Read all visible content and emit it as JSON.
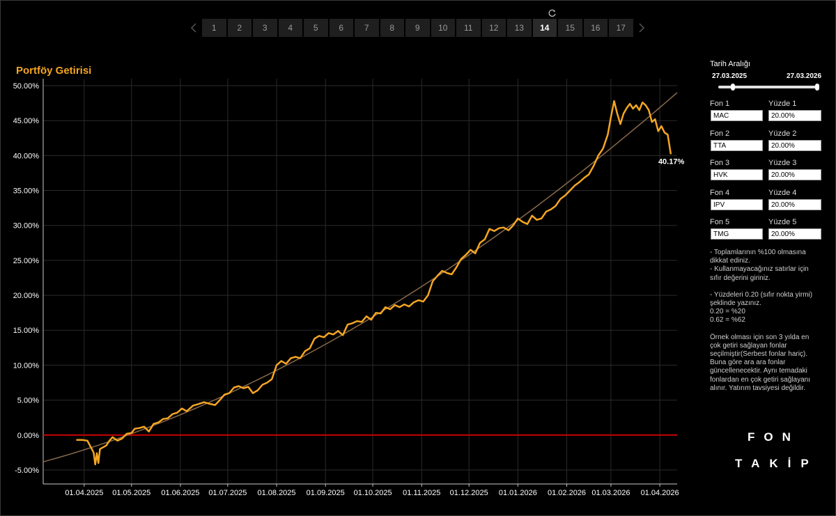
{
  "pager": {
    "pages": [
      "1",
      "2",
      "3",
      "4",
      "5",
      "6",
      "7",
      "8",
      "9",
      "10",
      "11",
      "12",
      "13",
      "14",
      "15",
      "16",
      "17"
    ],
    "active": "14",
    "prev_icon": "chevron-left-icon",
    "next_icon": "chevron-right-icon",
    "refresh_icon": "refresh-icon"
  },
  "chart": {
    "title": "Portföy Getirisi",
    "last_label": "40.17%"
  },
  "chart_data": {
    "type": "line",
    "title": "Portföy Getirisi",
    "ylim": [
      -7,
      51
    ],
    "y_ticks": [
      "-5.00%",
      "0.00%",
      "5.00%",
      "10.00%",
      "15.00%",
      "20.00%",
      "25.00%",
      "30.00%",
      "35.00%",
      "40.00%",
      "45.00%",
      "50.00%"
    ],
    "x_ticks": [
      "01.04.2025",
      "01.05.2025",
      "01.06.2025",
      "01.07.2025",
      "01.08.2025",
      "01.09.2025",
      "01.10.2025",
      "01.11.2025",
      "01.12.2025",
      "01.01.2026",
      "01.02.2026",
      "01.03.2026",
      "01.04.2026"
    ],
    "x_range": [
      "2025-03-06",
      "2026-04-12"
    ],
    "grid": true,
    "colors": {
      "portfolio": "#f5a623",
      "trend": "#8a6a4a",
      "zero": "#cc0000"
    },
    "series": [
      {
        "points": [
          [
            "2025-03-27",
            -0.7
          ],
          [
            "2025-03-31",
            -0.7
          ],
          [
            "2025-04-03",
            -0.8
          ],
          [
            "2025-04-07",
            -2.5
          ],
          [
            "2025-04-08",
            -4.2
          ],
          [
            "2025-04-09",
            -2.6
          ],
          [
            "2025-04-10",
            -4.0
          ],
          [
            "2025-04-11",
            -2.0
          ],
          [
            "2025-04-15",
            -1.5
          ],
          [
            "2025-04-17",
            -0.8
          ],
          [
            "2025-04-19",
            -0.3
          ],
          [
            "2025-04-22",
            -0.8
          ],
          [
            "2025-04-25",
            -0.5
          ],
          [
            "2025-04-28",
            0.2
          ],
          [
            "2025-05-01",
            0.3
          ],
          [
            "2025-05-03",
            0.9
          ],
          [
            "2025-05-06",
            1.0
          ],
          [
            "2025-05-09",
            1.2
          ],
          [
            "2025-05-12",
            0.5
          ],
          [
            "2025-05-15",
            1.6
          ],
          [
            "2025-05-18",
            1.8
          ],
          [
            "2025-05-21",
            2.3
          ],
          [
            "2025-05-24",
            2.4
          ],
          [
            "2025-05-27",
            3.0
          ],
          [
            "2025-05-30",
            3.2
          ],
          [
            "2025-06-02",
            3.8
          ],
          [
            "2025-06-05",
            3.4
          ],
          [
            "2025-06-09",
            4.2
          ],
          [
            "2025-06-12",
            4.4
          ],
          [
            "2025-06-16",
            4.7
          ],
          [
            "2025-06-19",
            4.5
          ],
          [
            "2025-06-23",
            4.3
          ],
          [
            "2025-06-26",
            5.0
          ],
          [
            "2025-06-29",
            5.8
          ],
          [
            "2025-07-02",
            6.0
          ],
          [
            "2025-07-05",
            6.8
          ],
          [
            "2025-07-08",
            7.0
          ],
          [
            "2025-07-11",
            6.7
          ],
          [
            "2025-07-14",
            6.9
          ],
          [
            "2025-07-17",
            6.0
          ],
          [
            "2025-07-20",
            6.4
          ],
          [
            "2025-07-23",
            7.2
          ],
          [
            "2025-07-26",
            7.5
          ],
          [
            "2025-07-29",
            8.0
          ],
          [
            "2025-08-01",
            10.0
          ],
          [
            "2025-08-04",
            10.6
          ],
          [
            "2025-08-07",
            10.2
          ],
          [
            "2025-08-10",
            11.0
          ],
          [
            "2025-08-13",
            11.2
          ],
          [
            "2025-08-16",
            11.0
          ],
          [
            "2025-08-19",
            12.0
          ],
          [
            "2025-08-22",
            12.4
          ],
          [
            "2025-08-25",
            13.8
          ],
          [
            "2025-08-28",
            14.2
          ],
          [
            "2025-08-31",
            14.0
          ],
          [
            "2025-09-03",
            14.6
          ],
          [
            "2025-09-06",
            14.4
          ],
          [
            "2025-09-09",
            14.9
          ],
          [
            "2025-09-12",
            14.3
          ],
          [
            "2025-09-15",
            15.8
          ],
          [
            "2025-09-18",
            16.0
          ],
          [
            "2025-09-21",
            16.3
          ],
          [
            "2025-09-24",
            16.2
          ],
          [
            "2025-09-27",
            17.0
          ],
          [
            "2025-09-30",
            16.5
          ],
          [
            "2025-10-03",
            17.5
          ],
          [
            "2025-10-06",
            17.4
          ],
          [
            "2025-10-09",
            18.3
          ],
          [
            "2025-10-12",
            18.0
          ],
          [
            "2025-10-15",
            18.6
          ],
          [
            "2025-10-18",
            18.3
          ],
          [
            "2025-10-21",
            18.7
          ],
          [
            "2025-10-24",
            18.4
          ],
          [
            "2025-10-27",
            19.0
          ],
          [
            "2025-10-30",
            19.3
          ],
          [
            "2025-11-02",
            19.1
          ],
          [
            "2025-11-05",
            20.0
          ],
          [
            "2025-11-08",
            22.0
          ],
          [
            "2025-11-11",
            22.8
          ],
          [
            "2025-11-14",
            23.5
          ],
          [
            "2025-11-17",
            23.2
          ],
          [
            "2025-11-20",
            23.0
          ],
          [
            "2025-11-23",
            24.0
          ],
          [
            "2025-11-26",
            25.2
          ],
          [
            "2025-11-29",
            25.8
          ],
          [
            "2025-12-02",
            26.5
          ],
          [
            "2025-12-05",
            26.0
          ],
          [
            "2025-12-08",
            27.5
          ],
          [
            "2025-12-11",
            28.0
          ],
          [
            "2025-12-14",
            29.5
          ],
          [
            "2025-12-17",
            29.2
          ],
          [
            "2025-12-20",
            29.6
          ],
          [
            "2025-12-23",
            29.7
          ],
          [
            "2025-12-26",
            29.3
          ],
          [
            "2025-12-29",
            30.0
          ],
          [
            "2026-01-01",
            31.0
          ],
          [
            "2026-01-04",
            30.5
          ],
          [
            "2026-01-07",
            30.2
          ],
          [
            "2026-01-10",
            31.4
          ],
          [
            "2026-01-13",
            30.8
          ],
          [
            "2026-01-16",
            31.0
          ],
          [
            "2026-01-19",
            32.0
          ],
          [
            "2026-01-22",
            32.3
          ],
          [
            "2026-01-25",
            32.8
          ],
          [
            "2026-01-28",
            33.8
          ],
          [
            "2026-01-31",
            34.3
          ],
          [
            "2026-02-03",
            35.0
          ],
          [
            "2026-02-06",
            35.7
          ],
          [
            "2026-02-09",
            36.2
          ],
          [
            "2026-02-12",
            36.8
          ],
          [
            "2026-02-15",
            37.3
          ],
          [
            "2026-02-18",
            38.5
          ],
          [
            "2026-02-21",
            40.0
          ],
          [
            "2026-02-24",
            41.0
          ],
          [
            "2026-02-27",
            43.0
          ],
          [
            "2026-03-01",
            45.5
          ],
          [
            "2026-03-03",
            47.8
          ],
          [
            "2026-03-05",
            46.0
          ],
          [
            "2026-03-07",
            44.5
          ],
          [
            "2026-03-09",
            46.0
          ],
          [
            "2026-03-11",
            46.8
          ],
          [
            "2026-03-13",
            47.4
          ],
          [
            "2026-03-15",
            46.7
          ],
          [
            "2026-03-17",
            47.2
          ],
          [
            "2026-03-19",
            46.5
          ],
          [
            "2026-03-21",
            47.6
          ],
          [
            "2026-03-23",
            47.2
          ],
          [
            "2026-03-25",
            46.5
          ],
          [
            "2026-03-27",
            44.8
          ],
          [
            "2026-03-29",
            45.2
          ],
          [
            "2026-03-31",
            43.5
          ],
          [
            "2026-04-02",
            44.2
          ],
          [
            "2026-04-04",
            43.3
          ],
          [
            "2026-04-06",
            43.0
          ],
          [
            "2026-04-08",
            40.2
          ]
        ]
      },
      {
        "trend": true
      }
    ]
  },
  "panel": {
    "range_title": "Tarih Aralığı",
    "range_start": "27.03.2025",
    "range_end": "27.03.2026",
    "funds": [
      {
        "label": "Fon 1",
        "code": "MAC",
        "pct_label": "Yüzde 1",
        "pct": "20.00%"
      },
      {
        "label": "Fon 2",
        "code": "TTA",
        "pct_label": "Yüzde 2",
        "pct": "20.00%"
      },
      {
        "label": "Fon 3",
        "code": "HVK",
        "pct_label": "Yüzde 3",
        "pct": "20.00%"
      },
      {
        "label": "Fon 4",
        "code": "IPV",
        "pct_label": "Yüzde 4",
        "pct": "20.00%"
      },
      {
        "label": "Fon 5",
        "code": "TMG",
        "pct_label": "Yüzde 5",
        "pct": "20.00%"
      }
    ],
    "notes": [
      "- Toplamlarının %100 olmasına dikkat ediniz.",
      "- Kullanmayacağınız satırlar için sıfır değerini giriniz.",
      "",
      "- Yüzdeleri 0.20 (sıfır nokta yirmi) şeklinde yazınız.",
      "0.20 = %20",
      "0.62 = %62",
      "",
      "Örnek olması için son 3 yılda en çok getiri sağlayan fonlar seçilmiştir(Serbest fonlar hariç). Buna göre ara ara fonlar güncellenecektir. Aynı temadaki fonlardan en çok getiri sağlayanı alınır. Yatırım tavsiyesi değildir."
    ]
  },
  "brand": {
    "line1": "FON",
    "line2": "TAKİP"
  }
}
